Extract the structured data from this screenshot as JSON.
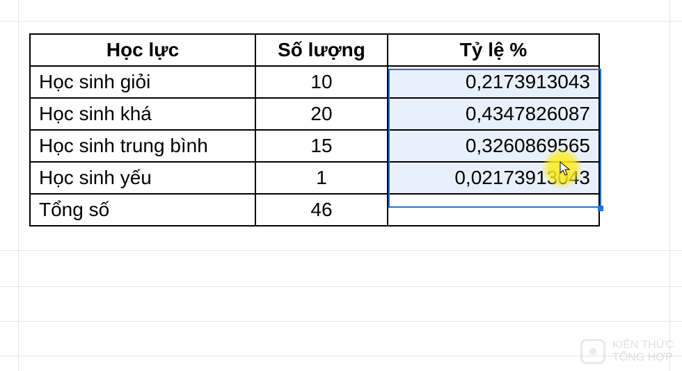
{
  "chart_data": {
    "type": "table",
    "headers": [
      "Học lực",
      "Số lượng",
      "Tỷ lệ %"
    ],
    "rows": [
      {
        "category": "Học sinh giỏi",
        "quantity": "10",
        "percent": "0,2173913043"
      },
      {
        "category": "Học sinh khá",
        "quantity": "20",
        "percent": "0,4347826087"
      },
      {
        "category": "Học sinh trung bình",
        "quantity": "15",
        "percent": "0,3260869565"
      },
      {
        "category": "Học sinh yếu",
        "quantity": "1",
        "percent": "0,02173913043"
      }
    ],
    "total": {
      "label": "Tổng số",
      "quantity": "46",
      "percent": ""
    }
  },
  "watermark": {
    "line1": "KIẾN THỨC",
    "line2": "TỔNG HỢP"
  },
  "colors": {
    "selection_fill": "#e8f0fb",
    "selection_border": "#1a73e8"
  }
}
